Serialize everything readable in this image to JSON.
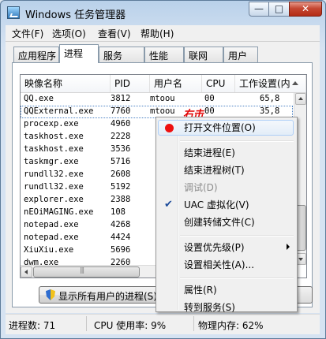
{
  "window": {
    "title": "Windows 任务管理器",
    "buttons": {
      "minimize": "—",
      "maximize": "□",
      "close": "✕"
    }
  },
  "menu": [
    "文件(F)",
    "选项(O)",
    "查看(V)",
    "帮助(H)"
  ],
  "tabs": [
    "应用程序",
    "进程",
    "服务",
    "性能",
    "联网",
    "用户"
  ],
  "active_tab": "进程",
  "table": {
    "columns": [
      "映像名称",
      "PID",
      "用户名",
      "CPU",
      "工作设置(内"
    ],
    "rows": [
      {
        "name": "QQ.exe",
        "pid": "3812",
        "user": "mtoou",
        "cpu": "00",
        "mem": "65,8"
      },
      {
        "name": "QQExternal.exe",
        "pid": "7760",
        "user": "mtoou",
        "cpu": "00",
        "mem": "35,8"
      },
      {
        "name": "procexp.exe",
        "pid": "4960",
        "user": "",
        "cpu": "",
        "mem": ""
      },
      {
        "name": "taskhost.exe",
        "pid": "2228",
        "user": "",
        "cpu": "",
        "mem": ""
      },
      {
        "name": "taskhost.exe",
        "pid": "3536",
        "user": "",
        "cpu": "",
        "mem": ""
      },
      {
        "name": "taskmgr.exe",
        "pid": "5716",
        "user": "",
        "cpu": "",
        "mem": ""
      },
      {
        "name": "rundll32.exe",
        "pid": "2608",
        "user": "",
        "cpu": "",
        "mem": ""
      },
      {
        "name": "rundll32.exe",
        "pid": "5192",
        "user": "",
        "cpu": "",
        "mem": ""
      },
      {
        "name": "explorer.exe",
        "pid": "2388",
        "user": "",
        "cpu": "",
        "mem": ""
      },
      {
        "name": "nEOiMAGING.exe",
        "pid": "108",
        "user": "",
        "cpu": "",
        "mem": ""
      },
      {
        "name": "notepad.exe",
        "pid": "4268",
        "user": "",
        "cpu": "",
        "mem": ""
      },
      {
        "name": "notepad.exe",
        "pid": "4424",
        "user": "",
        "cpu": "",
        "mem": ""
      },
      {
        "name": "XiuXiu.exe",
        "pid": "5696",
        "user": "",
        "cpu": "",
        "mem": ""
      },
      {
        "name": "dwm.exe",
        "pid": "2260",
        "user": "",
        "cpu": "",
        "mem": ""
      }
    ],
    "selected_row": 1
  },
  "annotation": "右击",
  "show_all_button": "显示所有用户的进程(S)",
  "end_process_button": "结束进程(E)",
  "context_menu": {
    "items": [
      {
        "label": "打开文件位置(O)",
        "icon": "red-dot-icon",
        "highlighted": true
      },
      {
        "separator": true
      },
      {
        "label": "结束进程(E)"
      },
      {
        "label": "结束进程树(T)"
      },
      {
        "label": "调试(D)",
        "disabled": true
      },
      {
        "label": "UAC 虚拟化(V)",
        "icon": "check-icon",
        "checked": true
      },
      {
        "label": "创建转储文件(C)"
      },
      {
        "separator": true
      },
      {
        "label": "设置优先级(P)",
        "submenu": true
      },
      {
        "label": "设置相关性(A)..."
      },
      {
        "separator": true
      },
      {
        "label": "属性(R)"
      },
      {
        "label": "转到服务(S)"
      }
    ]
  },
  "status": {
    "processes": "进程数: 71",
    "cpu": "CPU 使用率: 9%",
    "memory": "物理内存: 62%"
  }
}
